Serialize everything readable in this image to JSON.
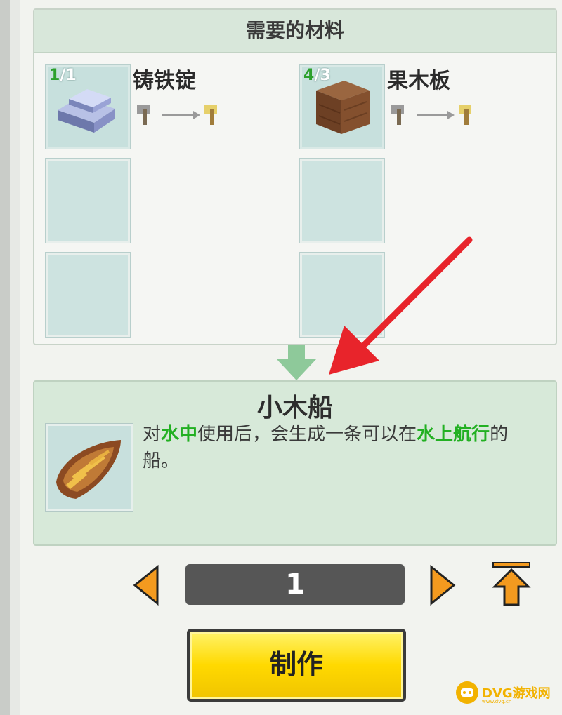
{
  "materials_panel": {
    "title": "需要的材料",
    "items": [
      {
        "name": "铸铁锭",
        "have": "1",
        "need": "/1",
        "icon": "iron-ingot-icon"
      },
      {
        "name": "果木板",
        "have": "4",
        "need": "/3",
        "icon": "fruitwood-plank-icon"
      }
    ]
  },
  "result": {
    "title": "小木船",
    "desc_1": "对",
    "desc_2": "水中",
    "desc_3": "使用后，会生成一条可以在",
    "desc_4": "水上航行",
    "desc_5": "的",
    "desc_line2": "船。",
    "icon": "wooden-boat-icon"
  },
  "quantity": {
    "value": "1"
  },
  "craft_button": {
    "label": "制作"
  },
  "watermark": {
    "text": "DVG游戏网",
    "sub": "www.dvg.cn"
  },
  "colors": {
    "highlight_green": "#22b022",
    "button_yellow": "#ffd900",
    "arrow_orange": "#f39a1f",
    "annotation_red": "#e8242b"
  }
}
